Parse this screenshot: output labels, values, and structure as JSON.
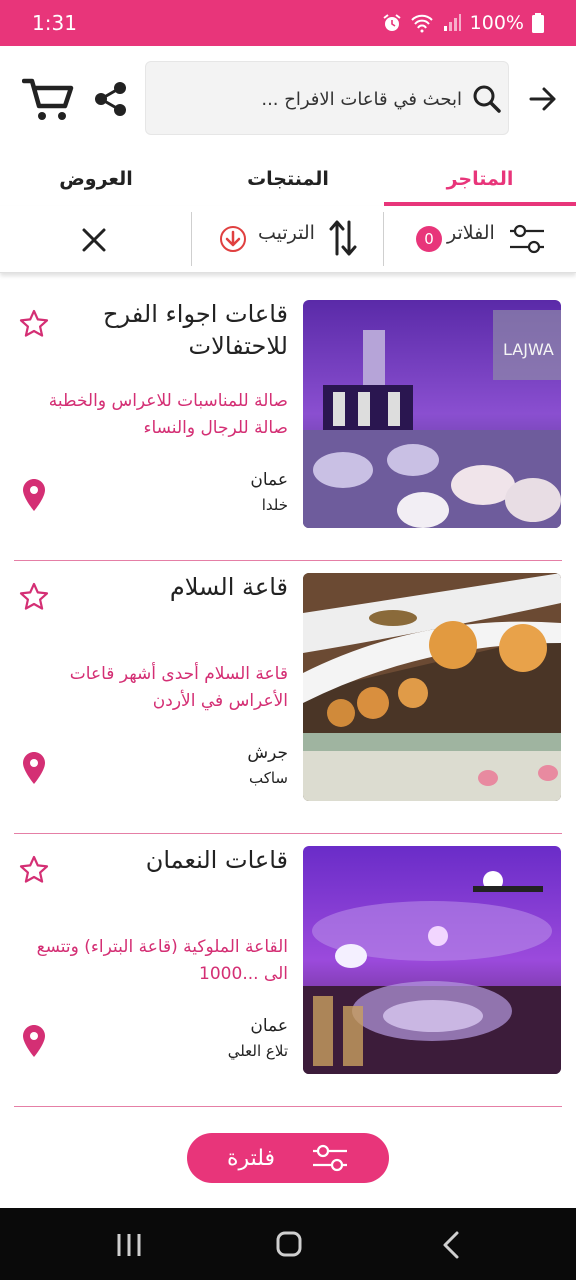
{
  "status_bar": {
    "time": "1:31",
    "battery": "100%"
  },
  "search": {
    "placeholder": "ابحث في قاعات الافراح ..."
  },
  "tabs": [
    {
      "label": "المتاجر",
      "active": true
    },
    {
      "label": "المنتجات",
      "active": false
    },
    {
      "label": "العروض",
      "active": false
    }
  ],
  "filters": {
    "filter_label": "الفلاتر",
    "filter_count": "0",
    "sort_label": "الترتيب"
  },
  "cards": [
    {
      "title": "قاعات اجواء الفرح للاحتفالات",
      "description": "صالة للمناسبات للاعراس والخطبة صالة للرجال والنساء",
      "city": "عمان",
      "area": "خلدا"
    },
    {
      "title": "قاعة السلام",
      "description": "قاعة السلام أحدى أشهر قاعات الأعراس في الأردن",
      "city": "جرش",
      "area": "ساكب"
    },
    {
      "title": "قاعات النعمان",
      "description": "القاعة الملوكية (قاعة البتراء) وتتسع الى ...1000",
      "city": "عمان",
      "area": "تلاع العلي"
    }
  ],
  "fab": {
    "label": "فلترة"
  },
  "colors": {
    "accent": "#e8357a",
    "description": "#d42f74"
  }
}
